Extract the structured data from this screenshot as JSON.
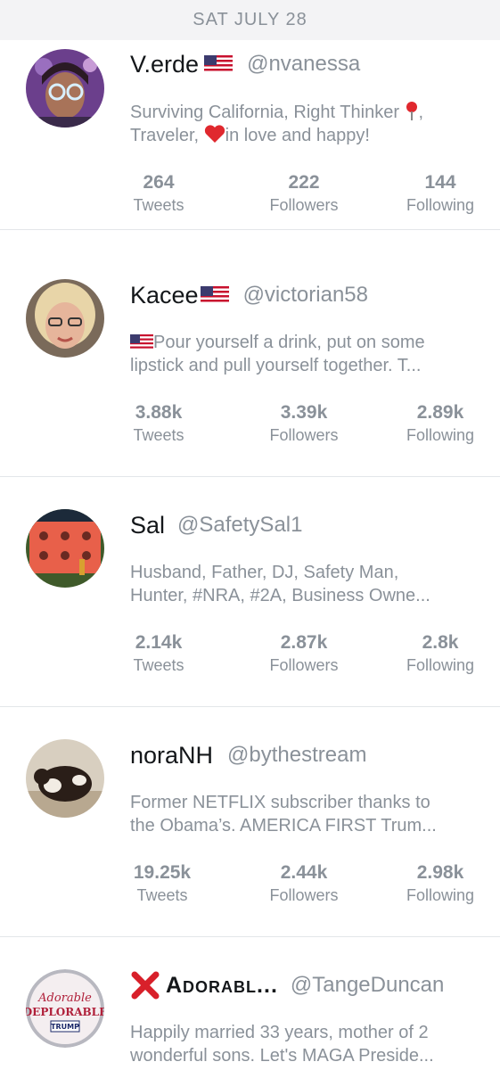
{
  "date_header": "SAT JULY 28",
  "labels": {
    "tweets": "Tweets",
    "followers": "Followers",
    "following": "Following"
  },
  "users": [
    {
      "name": "V.erde",
      "handle": "@nvanessa",
      "bio_line1_a": "Surviving California, Right Thinker",
      "bio_line1_b": ",",
      "bio_line2_a": "Traveler,",
      "bio_line2_b": "in love and happy!",
      "tweets": "264",
      "followers": "222",
      "following": "144"
    },
    {
      "name": "Kacee",
      "handle": "@victorian58",
      "bio_line1": "Pour yourself a drink, put on some",
      "bio_line2": "lipstick and pull yourself together. T...",
      "tweets": "3.88k",
      "followers": "3.39k",
      "following": "2.89k"
    },
    {
      "name": "Sal",
      "handle": "@SafetySal1",
      "bio_line1": "Husband, Father, DJ, Safety Man,",
      "bio_line2": "Hunter,  #NRA, #2A, Business Owne...",
      "tweets": "2.14k",
      "followers": "2.87k",
      "following": "2.8k"
    },
    {
      "name": "noraNH",
      "handle": "@bythestream",
      "bio_line1": "Former NETFLIX subscriber thanks to",
      "bio_line2": "the Obama’s.  AMERICA FIRST Trum...",
      "tweets": "19.25k",
      "followers": "2.44k",
      "following": "2.98k"
    },
    {
      "name": "Adorabl...",
      "handle": "@TangeDuncan",
      "bio_line1": "Happily married 33 years, mother of 2",
      "bio_line2": "wonderful sons. Let's MAGA Preside...",
      "avatar_text_1": "Adorable",
      "avatar_text_2": "DEPLORABLE",
      "avatar_text_3": "TRUMP"
    }
  ],
  "colors": {
    "header_bg": "#f3f3f5",
    "muted_text": "#8a9199",
    "primary_text": "#14171a",
    "divider": "#e3e6e9"
  }
}
